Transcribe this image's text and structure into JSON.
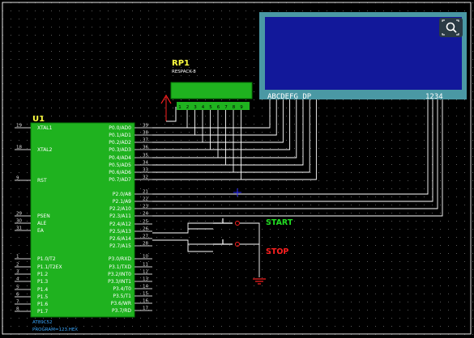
{
  "colors": {
    "background": "#000000",
    "grid_dot": "#5a5a5a",
    "border": "#e6e6e6",
    "chip_fill": "#1fb21f",
    "chip_border": "#0a7a0a",
    "wire": "#ffffff",
    "pin": "#cfcfcf",
    "designator": "#ffff40",
    "pin_number": "#e0e0e0",
    "lcd_bezel": "#4a98a4",
    "lcd_screen": "#12189a",
    "start_label": "#22dd22",
    "stop_label": "#ff2020",
    "power_arrow": "#ff2020",
    "caption": "#3aa8ff",
    "junction": "#2a2aff",
    "zoom_bg": "#2a3a44"
  },
  "zoom_button": {
    "icon": "zoom-icon"
  },
  "rp1": {
    "designator": "RP1",
    "value": "RESPACK-8",
    "pin_labels": [
      "1",
      "2",
      "3",
      "4",
      "5",
      "6",
      "7",
      "8",
      "9"
    ]
  },
  "lcd": {
    "segments_label": "ABCDEFG DP",
    "digits_label": "1234"
  },
  "u1": {
    "designator": "U1",
    "part": "AT89C52",
    "program": "PROGRAM=123.HEX",
    "left_pins": [
      {
        "num": "19",
        "name": "XTAL1"
      },
      {
        "num": "18",
        "name": "XTAL2"
      },
      {
        "num": "9",
        "name": "RST"
      },
      {
        "num": "29",
        "name": "PSEN"
      },
      {
        "num": "30",
        "name": "ALE"
      },
      {
        "num": "31",
        "name": "EA"
      },
      {
        "num": "1",
        "name": "P1.0/T2"
      },
      {
        "num": "2",
        "name": "P1.1/T2EX"
      },
      {
        "num": "3",
        "name": "P1.2"
      },
      {
        "num": "4",
        "name": "P1.3"
      },
      {
        "num": "5",
        "name": "P1.4"
      },
      {
        "num": "6",
        "name": "P1.5"
      },
      {
        "num": "7",
        "name": "P1.6"
      },
      {
        "num": "8",
        "name": "P1.7"
      }
    ],
    "right_pins": [
      {
        "num": "39",
        "name": "P0.0/AD0"
      },
      {
        "num": "38",
        "name": "P0.1/AD1"
      },
      {
        "num": "37",
        "name": "P0.2/AD2"
      },
      {
        "num": "36",
        "name": "P0.3/AD3"
      },
      {
        "num": "35",
        "name": "P0.4/AD4"
      },
      {
        "num": "34",
        "name": "P0.5/AD5"
      },
      {
        "num": "33",
        "name": "P0.6/AD6"
      },
      {
        "num": "32",
        "name": "P0.7/AD7"
      },
      {
        "num": "21",
        "name": "P2.0/A8"
      },
      {
        "num": "22",
        "name": "P2.1/A9"
      },
      {
        "num": "23",
        "name": "P2.2/A10"
      },
      {
        "num": "24",
        "name": "P2.3/A11"
      },
      {
        "num": "25",
        "name": "P2.4/A12"
      },
      {
        "num": "26",
        "name": "P2.5/A13"
      },
      {
        "num": "27",
        "name": "P2.6/A14"
      },
      {
        "num": "28",
        "name": "P2.7/A15"
      },
      {
        "num": "10",
        "name": "P3.0/RXD"
      },
      {
        "num": "11",
        "name": "P3.1/TXD"
      },
      {
        "num": "12",
        "name": "P3.2/INT0"
      },
      {
        "num": "13",
        "name": "P3.3/INT1"
      },
      {
        "num": "14",
        "name": "P3.4/T0"
      },
      {
        "num": "15",
        "name": "P3.5/T1"
      },
      {
        "num": "16",
        "name": "P3.6/WR"
      },
      {
        "num": "17",
        "name": "P3.7/RD"
      }
    ]
  },
  "buttons": {
    "start_label": "START",
    "stop_label": "STOP"
  }
}
